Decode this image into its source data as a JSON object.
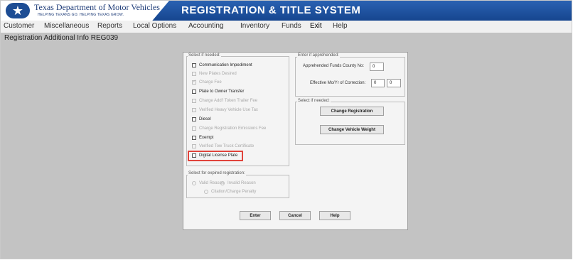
{
  "header": {
    "agency": "Texas Department of Motor Vehicles",
    "tagline": "HELPING TEXANS GO. HELPING TEXAS GROW.",
    "system_title": "REGISTRATION & TITLE SYSTEM"
  },
  "menu": {
    "items": [
      "Customer",
      "Miscellaneous",
      "Reports",
      "Local Options",
      "Accounting",
      "Inventory",
      "Funds",
      "Exit",
      "Help"
    ]
  },
  "screen": {
    "title": "Registration Additional Info REG039"
  },
  "dialog": {
    "select_if_needed_label": "Select if needed:",
    "options": [
      {
        "label": "Communication Impediment",
        "enabled": true,
        "checked": false
      },
      {
        "label": "New Plates Desired",
        "enabled": false,
        "checked": false
      },
      {
        "label": "Charge Fee",
        "enabled": false,
        "checked": true
      },
      {
        "label": "Plate to Owner Transfer",
        "enabled": true,
        "checked": false
      },
      {
        "label": "Charge Add'l Token Trailer Fee",
        "enabled": false,
        "checked": false
      },
      {
        "label": "Verified Heavy Vehicle Use Tax",
        "enabled": false,
        "checked": false
      },
      {
        "label": "Diesel",
        "enabled": true,
        "checked": false
      },
      {
        "label": "Charge Registration Emissions Fee",
        "enabled": false,
        "checked": false
      },
      {
        "label": "Exempt",
        "enabled": true,
        "checked": false
      },
      {
        "label": "Verified Tow Truck Certificate",
        "enabled": false,
        "checked": false
      },
      {
        "label": "Digital License Plate",
        "enabled": true,
        "checked": false
      }
    ],
    "expired": {
      "label": "Select for expired registration:",
      "valid_reason": "Valid Reason",
      "invalid_reason": "Invalid Reason",
      "citation_penalty": "Citation/Charge Penalty"
    },
    "apprehended": {
      "label": "Enter if apprehended:",
      "county_label": "Apprehended Funds County No:",
      "county_value": "0",
      "effective_label": "Effective Mo/Yr of Correction:",
      "effective_month": "0",
      "effective_year": "0"
    },
    "select_if_needed2_label": "Select if needed:",
    "change_registration": "Change Registration",
    "change_vehicle_weight": "Change Vehicle Weight",
    "buttons": {
      "enter": "Enter",
      "cancel": "Cancel",
      "help": "Help"
    }
  },
  "colors": {
    "header_blue": "#1f56a6",
    "highlight_red": "#e0443c",
    "workspace_gray": "#c3c3c3"
  }
}
